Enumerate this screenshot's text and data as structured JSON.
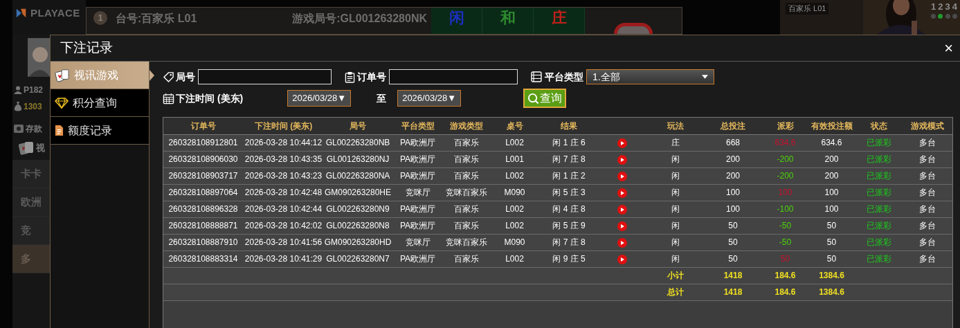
{
  "background": {
    "logo": "PLAYACE",
    "table_number": "1",
    "table_label": "台号:百家乐 L01",
    "round_label": "游戏局号:GL001263280NK",
    "bet_tiles": [
      {
        "label": "闲",
        "color": "#1a2fc0"
      },
      {
        "label": "和",
        "color": "#2e8b2e"
      },
      {
        "label": "庄",
        "color": "#c0201a"
      }
    ],
    "video_label": "百家乐 L01",
    "seats": [
      {
        "label": "1",
        "selected": false
      },
      {
        "label": "2",
        "selected": true
      },
      {
        "label": "3",
        "selected": false
      },
      {
        "label": "4",
        "selected": false
      }
    ],
    "player_id": "P182",
    "balance": "1303",
    "deposit": "存款",
    "game_link": "视",
    "lobby_items": [
      {
        "label": "卡卡",
        "selected": false
      },
      {
        "label": "欧洲",
        "selected": false
      },
      {
        "label": "竞",
        "selected": false
      },
      {
        "label": "多",
        "selected": true
      }
    ]
  },
  "dialog": {
    "title": "下注记录",
    "close": "×",
    "menu": [
      {
        "label": "视讯游戏",
        "kind": "cards",
        "selected": true
      },
      {
        "label": "积分查询",
        "kind": "diamond",
        "selected": false
      },
      {
        "label": "额度记录",
        "kind": "document",
        "selected": false
      }
    ],
    "filters": {
      "round_label": "局号",
      "order_label": "订单号",
      "platform_label": "平台类型",
      "platform_value": "1.全部",
      "time_label": "下注时间 (美东)",
      "date_from": "2026/03/28▼",
      "to_label": "至",
      "date_to": "2026/03/28▼",
      "query_button": "查询"
    },
    "table": {
      "columns": [
        "订单号",
        "下注时间 (美东)",
        "局号",
        "平台类型",
        "游戏类型",
        "桌号",
        "结果",
        "玩法",
        "总投注",
        "派彩",
        "有效投注额",
        "状态",
        "游戏模式"
      ],
      "rows": [
        {
          "order_no": "260328108912801",
          "bet_time": "2026-03-28 10:44:12",
          "round_no": "GL002263280NB",
          "platform": "PA欧洲厅",
          "game_type": "百家乐",
          "table_no": "L002",
          "result": "闲 1 庄 6",
          "bet_on": "庄",
          "total_bet": "668",
          "payout": {
            "text": "634.6",
            "color": "#c8102e"
          },
          "valid_bet": "634.6",
          "status": "已派彩",
          "game_mode": "多台"
        },
        {
          "order_no": "260328108906030",
          "bet_time": "2026-03-28 10:43:35",
          "round_no": "GL001263280NJ",
          "platform": "PA欧洲厅",
          "game_type": "百家乐",
          "table_no": "L001",
          "result": "闲 7 庄 8",
          "bet_on": "闲",
          "total_bet": "200",
          "payout": {
            "text": "-200",
            "color": "#4cd40a"
          },
          "valid_bet": "200",
          "status": "已派彩",
          "game_mode": "多台"
        },
        {
          "order_no": "260328108903717",
          "bet_time": "2026-03-28 10:43:23",
          "round_no": "GL002263280NA",
          "platform": "PA欧洲厅",
          "game_type": "百家乐",
          "table_no": "L002",
          "result": "闲 1 庄 2",
          "bet_on": "闲",
          "total_bet": "200",
          "payout": {
            "text": "-200",
            "color": "#4cd40a"
          },
          "valid_bet": "200",
          "status": "已派彩",
          "game_mode": "多台"
        },
        {
          "order_no": "260328108897064",
          "bet_time": "2026-03-28 10:42:48",
          "round_no": "GM090263280HE",
          "platform": "竞咪厅",
          "game_type": "竞咪百家乐",
          "table_no": "M090",
          "result": "闲 5 庄 3",
          "bet_on": "闲",
          "total_bet": "100",
          "payout": {
            "text": "100",
            "color": "#c8102e"
          },
          "valid_bet": "100",
          "status": "已派彩",
          "game_mode": "多台"
        },
        {
          "order_no": "260328108896328",
          "bet_time": "2026-03-28 10:42:44",
          "round_no": "GL002263280N9",
          "platform": "PA欧洲厅",
          "game_type": "百家乐",
          "table_no": "L002",
          "result": "闲 4 庄 8",
          "bet_on": "闲",
          "total_bet": "100",
          "payout": {
            "text": "-100",
            "color": "#4cd40a"
          },
          "valid_bet": "100",
          "status": "已派彩",
          "game_mode": "多台"
        },
        {
          "order_no": "260328108888871",
          "bet_time": "2026-03-28 10:42:02",
          "round_no": "GL002263280N8",
          "platform": "PA欧洲厅",
          "game_type": "百家乐",
          "table_no": "L002",
          "result": "闲 5 庄 9",
          "bet_on": "闲",
          "total_bet": "50",
          "payout": {
            "text": "-50",
            "color": "#4cd40a"
          },
          "valid_bet": "50",
          "status": "已派彩",
          "game_mode": "多台"
        },
        {
          "order_no": "260328108887910",
          "bet_time": "2026-03-28 10:41:56",
          "round_no": "GM090263280HD",
          "platform": "竞咪厅",
          "game_type": "竞咪百家乐",
          "table_no": "M090",
          "result": "闲 7 庄 8",
          "bet_on": "闲",
          "total_bet": "50",
          "payout": {
            "text": "-50",
            "color": "#4cd40a"
          },
          "valid_bet": "50",
          "status": "已派彩",
          "game_mode": "多台"
        },
        {
          "order_no": "260328108883314",
          "bet_time": "2026-03-28 10:41:29",
          "round_no": "GL002263280N7",
          "platform": "PA欧洲厅",
          "game_type": "百家乐",
          "table_no": "L002",
          "result": "闲 9 庄 5",
          "bet_on": "闲",
          "total_bet": "50",
          "payout": {
            "text": "50",
            "color": "#c8102e"
          },
          "valid_bet": "50",
          "status": "已派彩",
          "game_mode": "多台"
        }
      ],
      "summary": [
        {
          "label": "小计",
          "total_bet": "1418",
          "payout": "184.6",
          "valid_bet": "1384.6"
        },
        {
          "label": "总计",
          "total_bet": "1418",
          "payout": "184.6",
          "valid_bet": "1384.6"
        }
      ]
    }
  }
}
